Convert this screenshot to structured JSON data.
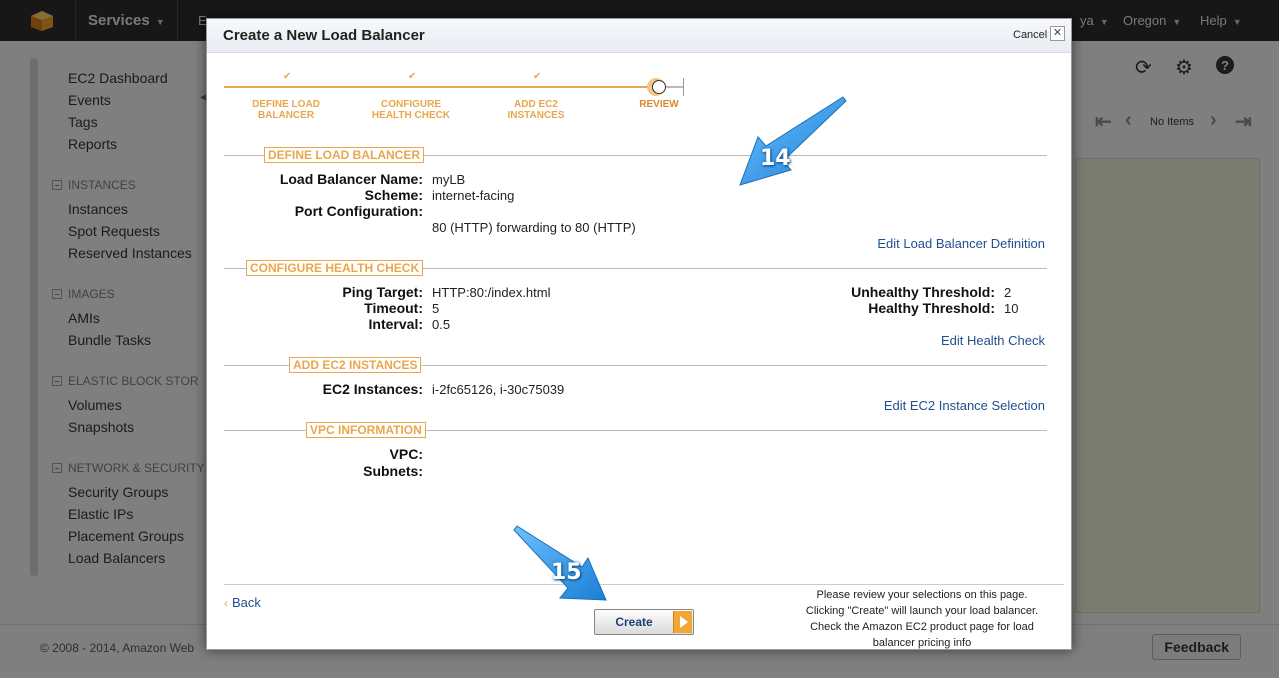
{
  "topbar": {
    "services_label": "Services",
    "e_fragment": "E",
    "user_fragment": "ya",
    "region_label": "Oregon",
    "help_label": "Help"
  },
  "sidebar": {
    "top_items": [
      "EC2 Dashboard",
      "Events",
      "Tags",
      "Reports"
    ],
    "sections": [
      {
        "heading": "INSTANCES",
        "items": [
          "Instances",
          "Spot Requests",
          "Reserved Instances"
        ]
      },
      {
        "heading": "IMAGES",
        "items": [
          "AMIs",
          "Bundle Tasks"
        ]
      },
      {
        "heading": "ELASTIC BLOCK STOR",
        "items": [
          "Volumes",
          "Snapshots"
        ]
      },
      {
        "heading": "NETWORK & SECURITY",
        "items": [
          "Security Groups",
          "Elastic IPs",
          "Placement Groups",
          "Load Balancers"
        ]
      }
    ]
  },
  "pager": {
    "status": "No Items"
  },
  "footer": {
    "copyright": "© 2008 - 2014, Amazon Web",
    "feedback_label": "Feedback"
  },
  "modal": {
    "title": "Create a New Load Balancer",
    "cancel_label": "Cancel",
    "close_glyph": "✕",
    "steps": [
      {
        "line1": "DEFINE LOAD",
        "line2": "BALANCER",
        "done": true
      },
      {
        "line1": "CONFIGURE",
        "line2": "HEALTH CHECK",
        "done": true
      },
      {
        "line1": "ADD EC2",
        "line2": "INSTANCES",
        "done": true
      },
      {
        "line1": "REVIEW",
        "line2": "",
        "done": false
      }
    ],
    "check_glyph": "✔",
    "define": {
      "title": "DEFINE LOAD BALANCER",
      "name_label": "Load Balancer Name:",
      "name_value": "myLB",
      "scheme_label": "Scheme:",
      "scheme_value": "internet-facing",
      "port_label": "Port Configuration:",
      "port_value": "80 (HTTP) forwarding to 80 (HTTP)",
      "edit_label": "Edit Load Balancer Definition"
    },
    "health": {
      "title": "CONFIGURE HEALTH CHECK",
      "ping_label": "Ping Target:",
      "ping_value": "HTTP:80:/index.html",
      "timeout_label": "Timeout:",
      "timeout_value": "5",
      "interval_label": "Interval:",
      "interval_value": "0.5",
      "unhealthy_label": "Unhealthy Threshold:",
      "unhealthy_value": "2",
      "healthy_label": "Healthy Threshold:",
      "healthy_value": "10",
      "edit_label": "Edit Health Check"
    },
    "instances": {
      "title": "ADD EC2 INSTANCES",
      "label": "EC2 Instances:",
      "value": "i-2fc65126, i-30c75039",
      "edit_label": "Edit EC2 Instance Selection"
    },
    "vpc": {
      "title": "VPC INFORMATION",
      "vpc_label": "VPC:",
      "subnets_label": "Subnets:"
    },
    "back_label": "Back",
    "create_label": "Create",
    "review_note": [
      "Please review your selections on this page.",
      "Clicking \"Create\" will launch your load balancer.",
      "Check the Amazon EC2 product page for load",
      "balancer pricing info"
    ]
  },
  "callouts": {
    "first": "14",
    "second": "15",
    "color": "#2a8fe0"
  }
}
